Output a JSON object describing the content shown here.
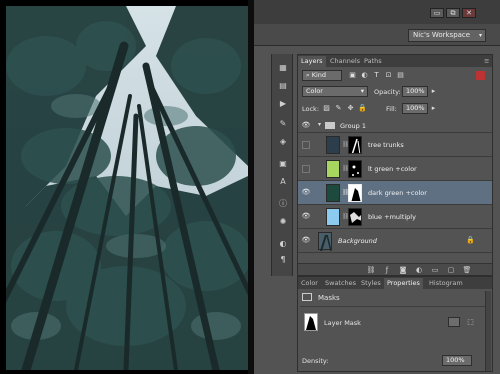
{
  "workspace": {
    "label": "Nic's Workspace"
  },
  "window_controls": [
    "▭",
    "⧉",
    "✕"
  ],
  "layers_panel": {
    "tabs": [
      {
        "label": "Layers",
        "active": true
      },
      {
        "label": "Channels",
        "active": false
      },
      {
        "label": "Paths",
        "active": false
      }
    ],
    "filter_kind": "Kind",
    "blend_mode": "Color",
    "opacity_label": "Opacity:",
    "opacity_value": "100%",
    "lock_label": "Lock:",
    "fill_label": "Fill:",
    "fill_value": "100%",
    "layers": [
      {
        "name": "Group 1",
        "kind": "group"
      },
      {
        "name": "tree trunks",
        "color": "#2c3e4c"
      },
      {
        "name": "lt green +color",
        "color": "#a8d760"
      },
      {
        "name": "dark green +color",
        "color": "#1d4a3c",
        "selected": true
      },
      {
        "name": "blue +multiply",
        "color": "#8ccaf0"
      },
      {
        "name": "Background",
        "color": "#4a5e6a"
      }
    ]
  },
  "props_panel": {
    "tabs": [
      {
        "label": "Color"
      },
      {
        "label": "Swatches"
      },
      {
        "label": "Styles"
      },
      {
        "label": "Properties",
        "active": true
      },
      {
        "label": "Histogram"
      }
    ],
    "section": "Masks",
    "mask_label": "Layer Mask",
    "density_label": "Density:",
    "density_value": "100%"
  }
}
